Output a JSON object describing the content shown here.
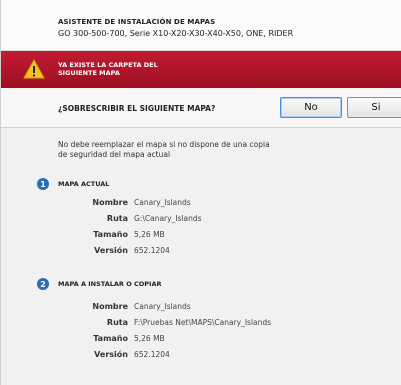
{
  "header": {
    "title": "ASISTENTE DE INSTALACIÓN DE MAPAS",
    "subtitle": "GO 300-500-700, Serie X10-X20-X30-X40-X50, ONE, RIDER"
  },
  "alert": {
    "line1": "YA EXISTE LA CARPETA DEL",
    "line2": "SIGUIENTE MAPA",
    "icon": "warning-icon",
    "color": "#b5162b"
  },
  "question": {
    "text": "¿SOBRESCRIBIR EL SIGUIENTE MAPA?",
    "no_label": "No",
    "si_label": "Si"
  },
  "warning_text": {
    "line1": "No debe reemplazar el mapa si no dispone de una copia",
    "line2": "de seguridad del mapa actual"
  },
  "current_map": {
    "number": "1",
    "title": "MAPA ACTUAL",
    "fields": [
      {
        "label": "Nombre",
        "value": "Canary_Islands"
      },
      {
        "label": "Ruta",
        "value": "G:\\Canary_Islands"
      },
      {
        "label": "Tamaño",
        "value": "5,26 MB"
      },
      {
        "label": "Versión",
        "value": "652.1204"
      }
    ]
  },
  "new_map": {
    "number": "2",
    "title": "MAPA A INSTALAR O COPIAR",
    "fields": [
      {
        "label": "Nombre",
        "value": "Canary_Islands"
      },
      {
        "label": "Ruta",
        "value": "F:\\Pruebas Net\\MAPS\\Canary_Islands"
      },
      {
        "label": "Tamaño",
        "value": "5,26 MB"
      },
      {
        "label": "Versión",
        "value": "652.1204"
      }
    ]
  }
}
